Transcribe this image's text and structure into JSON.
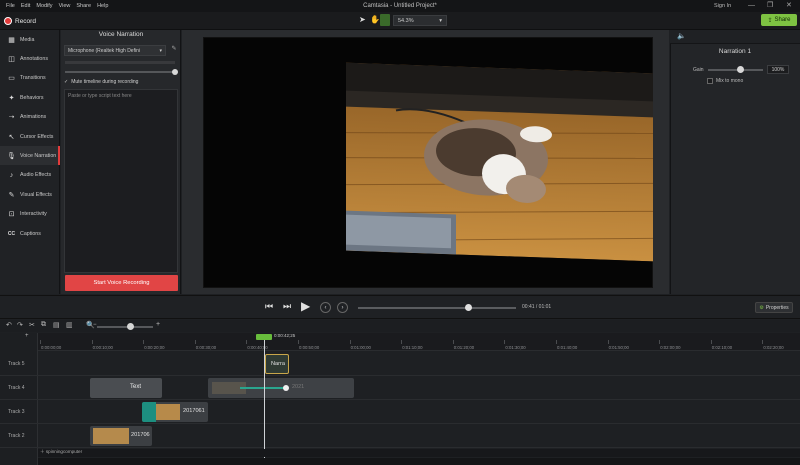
{
  "menubar": {
    "items": [
      "File",
      "Edit",
      "Modify",
      "View",
      "Share",
      "Help"
    ]
  },
  "window": {
    "title": "Camtasia - Untitled Project*",
    "sign_in": "Sign In"
  },
  "toolbar": {
    "record_label": "Record",
    "zoom_value": "54.3%",
    "share_label": "Share"
  },
  "sidebar": {
    "items": [
      {
        "label": "Media",
        "icon": "film-icon"
      },
      {
        "label": "Annotations",
        "icon": "annotation-icon"
      },
      {
        "label": "Transitions",
        "icon": "transition-icon"
      },
      {
        "label": "Behaviors",
        "icon": "behavior-icon"
      },
      {
        "label": "Animations",
        "icon": "animation-icon"
      },
      {
        "label": "Cursor Effects",
        "icon": "cursor-icon"
      },
      {
        "label": "Voice Narration",
        "icon": "microphone-icon"
      },
      {
        "label": "Audio Effects",
        "icon": "audio-icon"
      },
      {
        "label": "Visual Effects",
        "icon": "visual-effect-icon"
      },
      {
        "label": "Interactivity",
        "icon": "interactivity-icon"
      },
      {
        "label": "Captions",
        "icon": "captions-icon"
      }
    ],
    "active_index": 6
  },
  "narration_panel": {
    "title": "Voice Narration",
    "microphone": "Microphone (Realtek High Defini",
    "mute_label": "Mute timeline during recording",
    "script_placeholder": "Paste or type script text here",
    "record_button": "Start Voice Recording"
  },
  "properties": {
    "title": "Narration 1",
    "gain_label": "Gain",
    "gain_value": "100%",
    "mix_label": "Mix to mono",
    "button": "Properties"
  },
  "playback": {
    "time": "00:41 / 01:01"
  },
  "timeline": {
    "playhead_time": "0:00:42;25",
    "ruler_labels": [
      "0:00:00;00",
      "0:00:10;00",
      "0:00:20;00",
      "0:00:30;00",
      "0:00:40;00",
      "0:00:50;00",
      "0:01:00;00",
      "0:01:10;00",
      "0:01:20;00",
      "0:01:30;00",
      "0:01:40;00",
      "0:01:50;00",
      "0:02:00;00",
      "0:02:10;00",
      "0:02:20;00"
    ],
    "tracks": [
      "Track 5",
      "Track 4",
      "Track 3",
      "Track 2"
    ],
    "clips": {
      "narration": "Narra",
      "text": "Text",
      "faded": "2021",
      "track3_video": "2017061",
      "track2_video": "201706"
    },
    "library_tag": "spinningcomputer"
  },
  "colors": {
    "accent": "#7ec242",
    "record": "#e23b3b",
    "clip_teal": "#1d8f80"
  }
}
